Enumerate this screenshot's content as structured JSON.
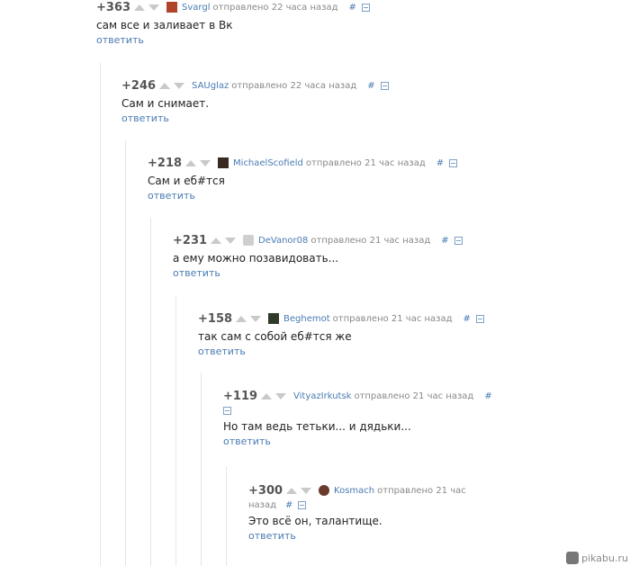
{
  "comments": [
    {
      "rating": "+363",
      "author": "Svargl",
      "sent": "отправлено 22 часа назад",
      "hash": "#",
      "text": "сам все и заливает в Вк",
      "reply": "ответить",
      "avatar_color": "#b0442a"
    },
    {
      "rating": "+246",
      "author": "SAUglaz",
      "sent": "отправлено 22 часа назад",
      "hash": "#",
      "text": "Сам и снимает.",
      "reply": "ответить",
      "avatar_color": ""
    },
    {
      "rating": "+218",
      "author": "MichaelScofield",
      "sent": "отправлено 21 час назад",
      "hash": "#",
      "text": "Сам и еб#тся",
      "reply": "ответить",
      "avatar_color": "#3a2a22"
    },
    {
      "rating": "+231",
      "author": "DeVanor08",
      "sent": "отправлено 21 час назад",
      "hash": "#",
      "text": "а ему можно позавидовать...",
      "reply": "ответить",
      "avatar_color": "#cfcfcf"
    },
    {
      "rating": "+158",
      "author": "Beghemot",
      "sent": "отправлено 21 час назад",
      "hash": "#",
      "text": "так сам с собой еб#тся же",
      "reply": "ответить",
      "avatar_color": "#2f3a2a"
    },
    {
      "rating": "+119",
      "author": "VityazIrkutsk",
      "sent": "отправлено 21 час назад",
      "hash": "#",
      "text": "Но там ведь тетьки... и дядьки...",
      "reply": "ответить",
      "avatar_color": ""
    },
    {
      "rating": "+300",
      "author": "Kosmach",
      "sent": "отправлено 21 час",
      "sent2": "назад",
      "hash": "#",
      "text": "Это всё он, талантище.",
      "reply": "ответить",
      "avatar_color": "#6a3a2a"
    }
  ],
  "watermark": "pikabu.ru"
}
